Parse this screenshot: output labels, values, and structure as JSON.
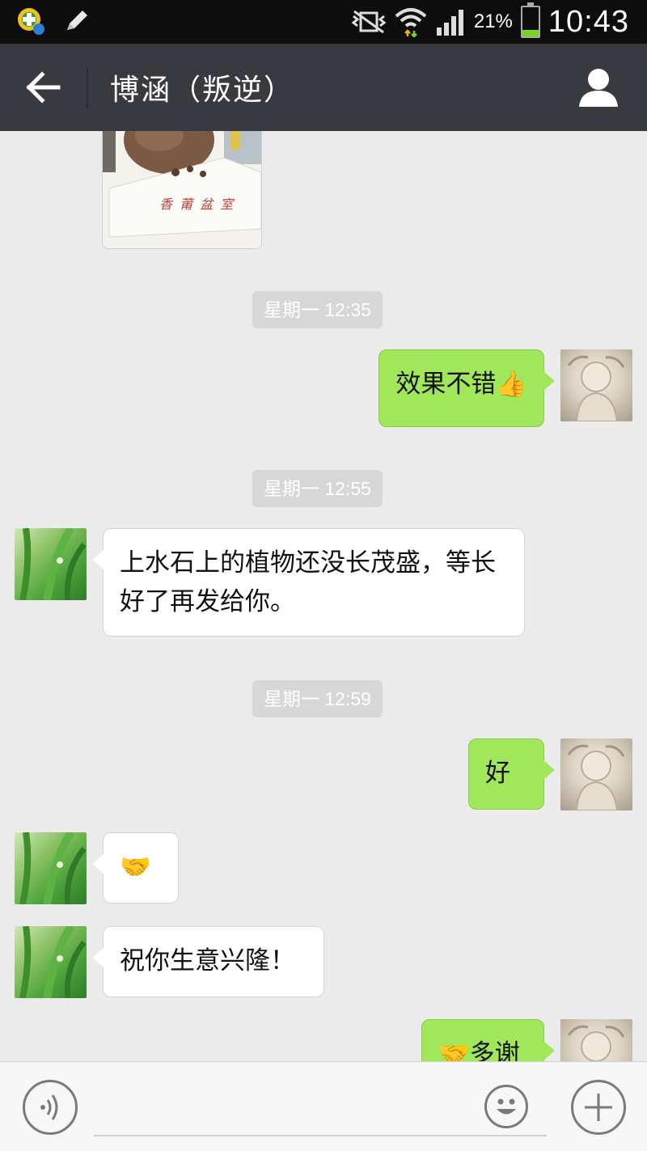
{
  "status_bar": {
    "battery_percent": "21%",
    "time": "10:43",
    "battery_level": 0.21
  },
  "header": {
    "title": "博涵（叛逆）",
    "back_icon": "arrow-left-icon",
    "contact_icon": "person-icon"
  },
  "messages": {
    "ts1": "星期一 12:35",
    "m1": "效果不错👍",
    "ts2": "星期一 12:55",
    "m2": "上水石上的植物还没长茂盛，等长好了再发给你。",
    "ts3": "星期一 12:59",
    "m3": "好",
    "m4": "🤝",
    "m5": "祝你生意兴隆！",
    "m6": "🤝多谢"
  },
  "image_message": {
    "caption": "香 莆 盆 室"
  },
  "input_bar": {
    "text_value": "",
    "voice_icon": "voice-icon",
    "emoji_icon": "smiley-icon",
    "plus_icon": "plus-icon"
  },
  "colors": {
    "title_bar": "#393a3f",
    "outgoing_bubble": "#a0e75a",
    "incoming_bubble": "#ffffff",
    "chat_background": "#ebebeb",
    "timestamp_bg": "#d7d7d7"
  }
}
